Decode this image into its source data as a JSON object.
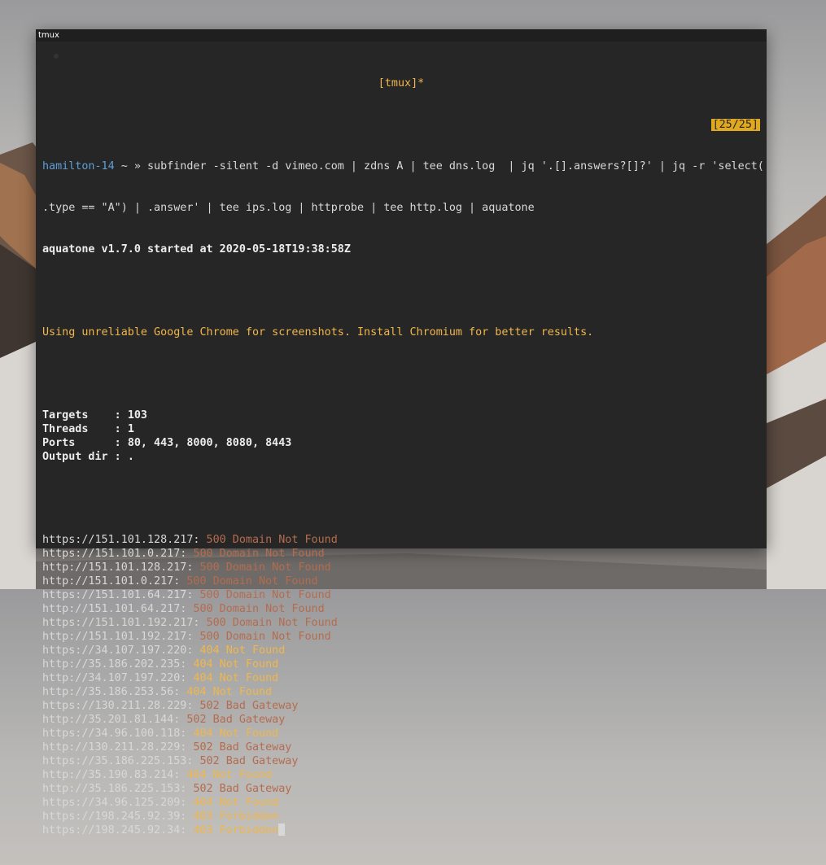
{
  "window": {
    "title": "tmux"
  },
  "tmux": {
    "status_title": "[tmux]*",
    "pane_counter": "[25/25]"
  },
  "prompt": {
    "host": "hamilton-14",
    "symbols": " ~ » ",
    "command_line1": "subfinder -silent -d vimeo.com | zdns A | tee dns.log  | jq '.[].answers?[]?' | jq -r 'select(",
    "command_line2": ".type == \"A\") | .answer' | tee ips.log | httprobe | tee http.log | aquatone"
  },
  "banner": "aquatone v1.7.0 started at 2020-05-18T19:38:58Z",
  "warning": "Using unreliable Google Chrome for screenshots. Install Chromium for better results.",
  "config": [
    {
      "label": "Targets    : ",
      "value": "103"
    },
    {
      "label": "Threads    : ",
      "value": "1"
    },
    {
      "label": "Ports      : ",
      "value": "80, 443, 8000, 8080, 8443"
    },
    {
      "label": "Output dir : ",
      "value": "."
    }
  ],
  "results": [
    {
      "url": "https://151.101.128.217: ",
      "status": "500 Domain Not Found",
      "code": "500"
    },
    {
      "url": "https://151.101.0.217: ",
      "status": "500 Domain Not Found",
      "code": "500"
    },
    {
      "url": "http://151.101.128.217: ",
      "status": "500 Domain Not Found",
      "code": "500"
    },
    {
      "url": "http://151.101.0.217: ",
      "status": "500 Domain Not Found",
      "code": "500"
    },
    {
      "url": "https://151.101.64.217: ",
      "status": "500 Domain Not Found",
      "code": "500"
    },
    {
      "url": "http://151.101.64.217: ",
      "status": "500 Domain Not Found",
      "code": "500"
    },
    {
      "url": "https://151.101.192.217: ",
      "status": "500 Domain Not Found",
      "code": "500"
    },
    {
      "url": "http://151.101.192.217: ",
      "status": "500 Domain Not Found",
      "code": "500"
    },
    {
      "url": "https://34.107.197.220: ",
      "status": "404 Not Found",
      "code": "404"
    },
    {
      "url": "http://35.186.202.235: ",
      "status": "404 Not Found",
      "code": "404"
    },
    {
      "url": "http://34.107.197.220: ",
      "status": "404 Not Found",
      "code": "404"
    },
    {
      "url": "http://35.186.253.56: ",
      "status": "404 Not Found",
      "code": "404"
    },
    {
      "url": "https://130.211.28.229: ",
      "status": "502 Bad Gateway",
      "code": "502"
    },
    {
      "url": "http://35.201.81.144: ",
      "status": "502 Bad Gateway",
      "code": "502"
    },
    {
      "url": "https://34.96.100.118: ",
      "status": "404 Not Found",
      "code": "404"
    },
    {
      "url": "http://130.211.28.229: ",
      "status": "502 Bad Gateway",
      "code": "502"
    },
    {
      "url": "https://35.186.225.153: ",
      "status": "502 Bad Gateway",
      "code": "502"
    },
    {
      "url": "http://35.190.83.214: ",
      "status": "404 Not Found",
      "code": "404"
    },
    {
      "url": "http://35.186.225.153: ",
      "status": "502 Bad Gateway",
      "code": "502"
    },
    {
      "url": "https://34.96.125.209: ",
      "status": "404 Not Found",
      "code": "404"
    },
    {
      "url": "https://198.245.92.39: ",
      "status": "403 Forbidden",
      "code": "403"
    },
    {
      "url": "https://198.245.92.34: ",
      "status": "403 Forbidden",
      "code": "403"
    }
  ],
  "colors": {
    "terminal_bg": "#262626",
    "host": "#5e9fd6",
    "warning": "#f0b64c",
    "status_5xx": "#b56c4e",
    "status_4xx": "#f0b64c",
    "badge": "#e0a81e"
  }
}
